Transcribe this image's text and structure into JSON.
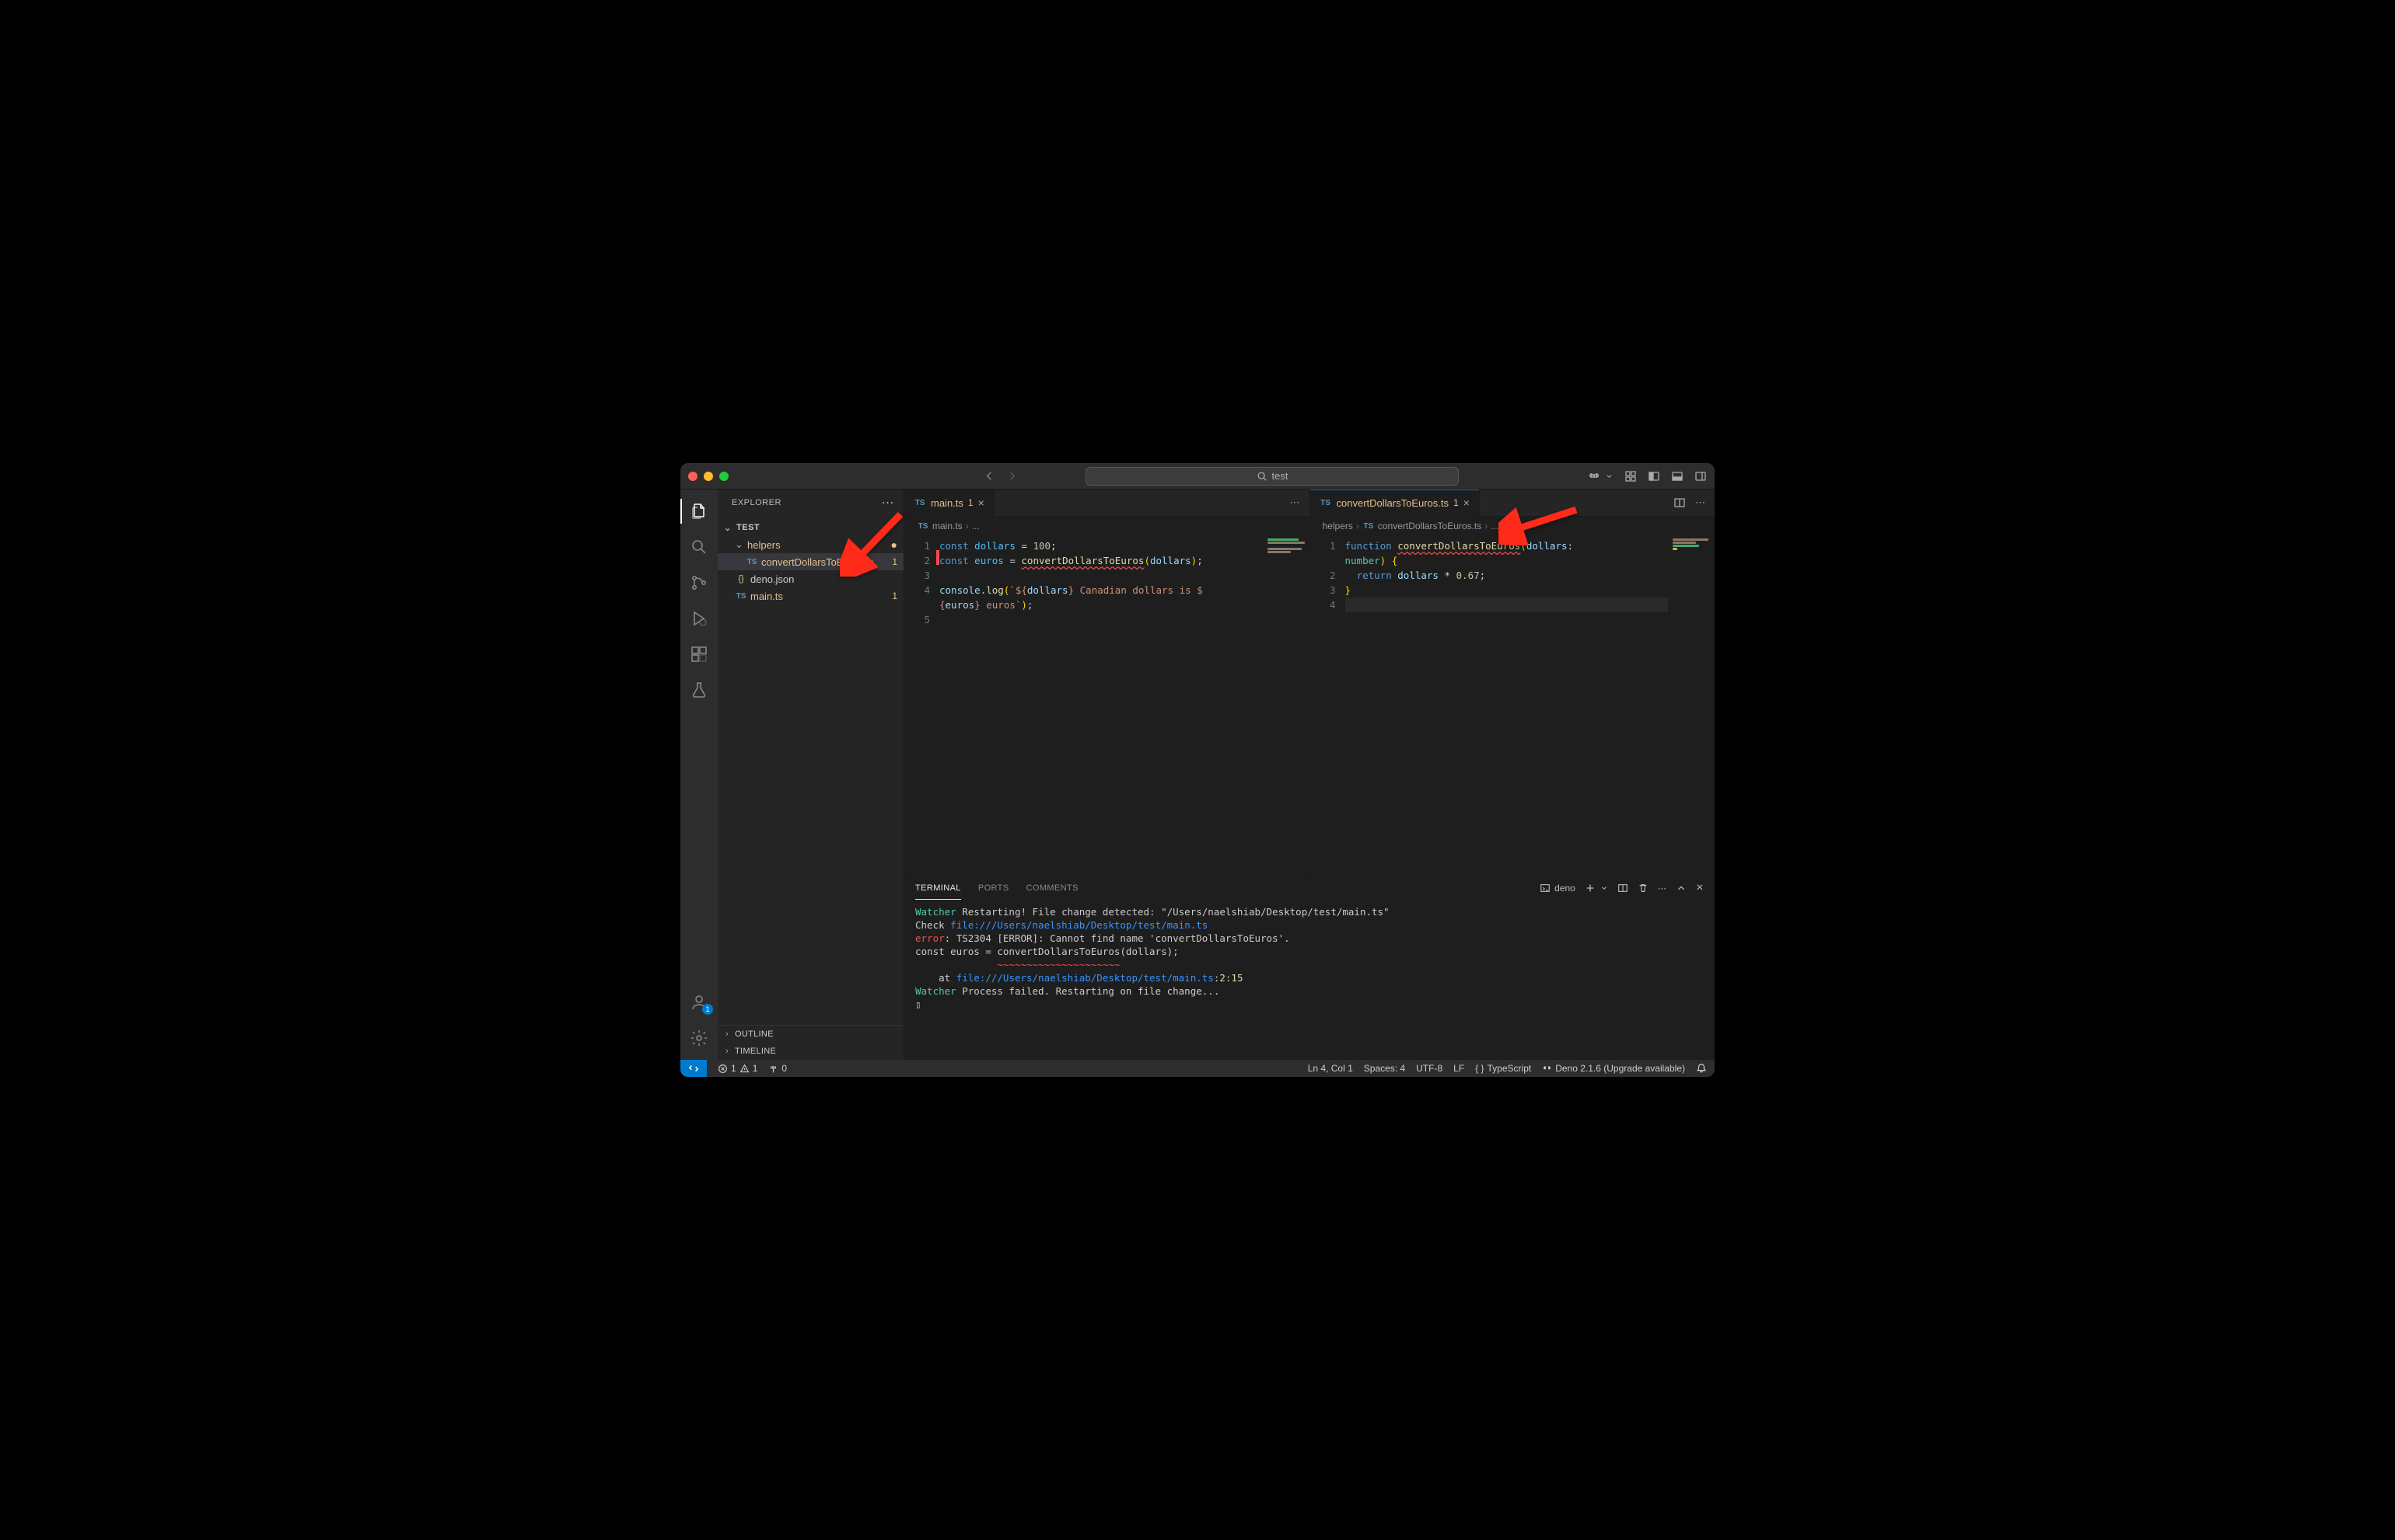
{
  "titlebar": {
    "search_placeholder": "test"
  },
  "sidebar": {
    "title": "EXPLORER",
    "root": "TEST",
    "folders": [
      {
        "name": "helpers",
        "modified": true
      }
    ],
    "files": [
      {
        "name": "convertDollarsToEuros.ts",
        "icon": "TS",
        "parent": "helpers",
        "badge": "1",
        "modified": true,
        "selected": true
      },
      {
        "name": "deno.json",
        "icon": "{}",
        "parent": "",
        "modified": false
      },
      {
        "name": "main.ts",
        "icon": "TS",
        "parent": "",
        "badge": "1",
        "modified": true
      }
    ],
    "outlines": [
      "OUTLINE",
      "TIMELINE"
    ]
  },
  "activity": {
    "account_badge": "1"
  },
  "editors": {
    "left": {
      "tab_name": "main.ts",
      "tab_badge": "1",
      "breadcrumb": [
        "main.ts",
        "..."
      ],
      "lines": [
        {
          "n": 1,
          "tokens": [
            [
              "const",
              "kw"
            ],
            [
              " ",
              "op"
            ],
            [
              "dollars",
              "const"
            ],
            [
              " = ",
              "op"
            ],
            [
              "100",
              "num"
            ],
            [
              ";",
              "punc"
            ]
          ]
        },
        {
          "n": 2,
          "tokens": [
            [
              "const",
              "kw"
            ],
            [
              " ",
              "op"
            ],
            [
              "euros",
              "const"
            ],
            [
              " = ",
              "op"
            ],
            [
              "convertDollarsToEuros",
              "fn-squiggle"
            ],
            [
              "(",
              "brace"
            ],
            [
              "dollars",
              "var"
            ],
            [
              ")",
              "brace"
            ],
            [
              ";",
              "punc"
            ]
          ]
        },
        {
          "n": 3,
          "tokens": []
        },
        {
          "n": 4,
          "tokens": [
            [
              "console",
              "var"
            ],
            [
              ".",
              "punc"
            ],
            [
              "log",
              "fn"
            ],
            [
              "(",
              "brace"
            ],
            [
              "`${",
              "str"
            ],
            [
              "dollars",
              "var"
            ],
            [
              "}",
              "str"
            ],
            [
              " Canadian dollars is $",
              "str"
            ]
          ]
        },
        {
          "n": "",
          "tokens": [
            [
              "{",
              "str"
            ],
            [
              "euros",
              "var"
            ],
            [
              "}",
              "str"
            ],
            [
              " euros`",
              "str"
            ],
            [
              ")",
              "brace"
            ],
            [
              ";",
              "punc"
            ]
          ]
        },
        {
          "n": 5,
          "tokens": []
        }
      ]
    },
    "right": {
      "tab_name": "convertDollarsToEuros.ts",
      "tab_badge": "1",
      "breadcrumb": [
        "helpers",
        "convertDollarsToEuros.ts",
        "..."
      ],
      "lines": [
        {
          "n": 1,
          "tokens": [
            [
              "function",
              "kw"
            ],
            [
              " ",
              "op"
            ],
            [
              "convertDollarsToEuros",
              "fn-squiggle"
            ],
            [
              "(",
              "brace"
            ],
            [
              "dollars",
              "var"
            ],
            [
              ": ",
              "punc"
            ]
          ]
        },
        {
          "n": "",
          "tokens": [
            [
              "number",
              "type"
            ],
            [
              ")",
              "brace"
            ],
            [
              " {",
              "brace"
            ]
          ]
        },
        {
          "n": 2,
          "tokens": [
            [
              "  ",
              "op"
            ],
            [
              "return",
              "kw"
            ],
            [
              " ",
              "op"
            ],
            [
              "dollars",
              "var"
            ],
            [
              " * ",
              "op"
            ],
            [
              "0.67",
              "num"
            ],
            [
              ";",
              "punc"
            ]
          ]
        },
        {
          "n": 3,
          "tokens": [
            [
              "}",
              "brace"
            ]
          ]
        },
        {
          "n": 4,
          "tokens": [],
          "hl": true
        }
      ]
    }
  },
  "panel": {
    "tabs": [
      "TERMINAL",
      "PORTS",
      "COMMENTS"
    ],
    "active_tab": "TERMINAL",
    "term_name": "deno",
    "output": [
      [
        [
          "Watcher",
          "green"
        ],
        [
          " Restarting! File change detected: \"/Users/naelshiab/Desktop/test/main.ts\"",
          ""
        ]
      ],
      [
        [
          "Check",
          ""
        ],
        [
          " file:///Users/naelshiab/Desktop/test/main.ts",
          "link"
        ]
      ],
      [
        [
          "error",
          "red"
        ],
        [
          ": TS2304 [ERROR]: Cannot find name 'convertDollarsToEuros'.",
          ""
        ]
      ],
      [
        [
          "const euros = ",
          ""
        ],
        [
          "convertDollarsToEuros",
          ""
        ],
        [
          "(dollars);",
          ""
        ]
      ],
      [
        [
          "              ",
          ""
        ],
        [
          "~~~~~~~~~~~~~~~~~~~~~",
          "red"
        ]
      ],
      [
        [
          "    at ",
          ""
        ],
        [
          "file:///Users/naelshiab/Desktop/test/main.ts",
          "link"
        ],
        [
          ":",
          ""
        ],
        [
          "2",
          "yellow"
        ],
        [
          ":",
          ""
        ],
        [
          "15",
          "yellow"
        ]
      ],
      [
        [
          "Watcher",
          "green"
        ],
        [
          " Process failed. Restarting on file change...",
          ""
        ]
      ],
      [
        [
          "▯",
          ""
        ]
      ]
    ]
  },
  "statusbar": {
    "errors": "1",
    "warnings": "1",
    "ports": "0",
    "cursor": "Ln 4, Col 1",
    "spaces": "Spaces: 4",
    "encoding": "UTF-8",
    "eol": "LF",
    "language": "TypeScript",
    "deno": "Deno 2.1.6 (Upgrade available)"
  }
}
